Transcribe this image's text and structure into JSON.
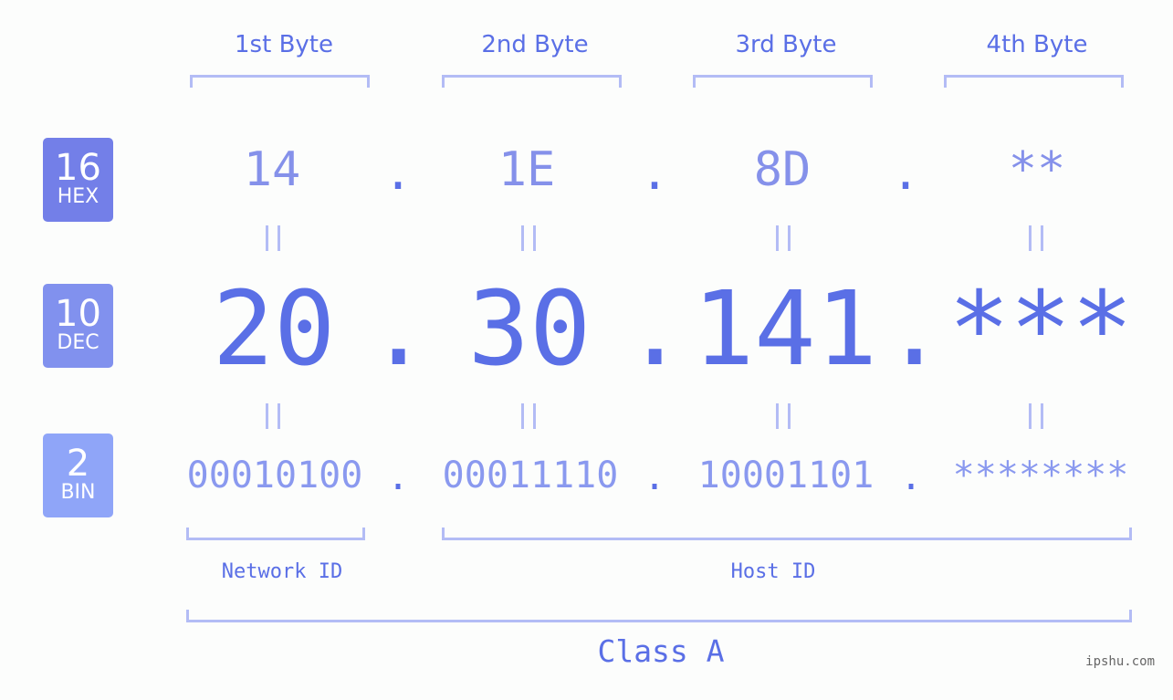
{
  "colors": {
    "hex_badge": "#737fe8",
    "dec_badge": "#8191ee",
    "bin_badge": "#8fa5f8",
    "primary_text": "#5a6fe6",
    "bracket": "#b3bcf5"
  },
  "bytes": [
    {
      "header": "1st Byte",
      "hex": "14",
      "dec": "20",
      "bin": "00010100"
    },
    {
      "header": "2nd Byte",
      "hex": "1E",
      "dec": "30",
      "bin": "00011110"
    },
    {
      "header": "3rd Byte",
      "hex": "8D",
      "dec": "141",
      "bin": "10001101"
    },
    {
      "header": "4th Byte",
      "hex": "**",
      "dec": "***",
      "bin": "********"
    }
  ],
  "separator": ".",
  "badges": {
    "hex": {
      "num": "16",
      "label": "HEX"
    },
    "dec": {
      "num": "10",
      "label": "DEC"
    },
    "bin": {
      "num": "2",
      "label": "BIN"
    }
  },
  "labels": {
    "network_id": "Network ID",
    "host_id": "Host ID",
    "class": "Class A"
  },
  "watermark": "ipshu.com"
}
